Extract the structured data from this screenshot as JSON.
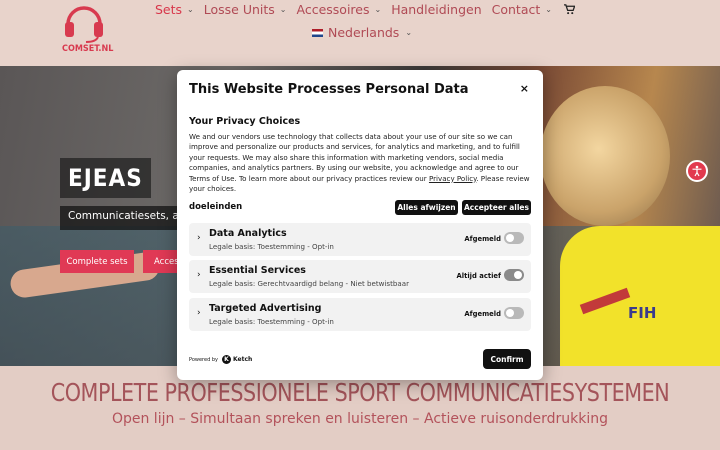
{
  "logo": {
    "text": "COMSET.NL",
    "icon": "headset-icon"
  },
  "nav": {
    "items": [
      {
        "label": "Sets",
        "active": true
      },
      {
        "label": "Losse Units"
      },
      {
        "label": "Accessoires"
      },
      {
        "label": "Handleidingen"
      },
      {
        "label": "Contact"
      }
    ],
    "cart_icon": "cart-icon",
    "language": "Nederlands",
    "chevron": "⌄"
  },
  "hero": {
    "brand": "EJEAS",
    "tagline": "Communicatiesets, accessoires",
    "button_complete": "Complete sets",
    "button_access": "Accessoires"
  },
  "footer": {
    "headline": "COMPLETE PROFESSIONELE SPORT COMMUNICATIESYSTEMEN",
    "subline": "Open lijn – Simultaan spreken en luisteren – Actieve ruisonderdrukking"
  },
  "consent": {
    "title": "This Website Processes Personal Data",
    "close": "×",
    "subtitle": "Your Privacy Choices",
    "body_pre": "We and our vendors use technology that collects data about your use of our site so we can improve and personalize our products and services, for analytics and marketing, and to fulfill your requests. We may also share this information with marketing vendors, social media companies, and analytics partners. By using our website, you acknowledge and agree to our Terms of Use. To learn more about our privacy practices review our ",
    "body_link": "Privacy Policy",
    "body_post": ". Please review your choices.",
    "purposes_label": "doeleinden",
    "reject_all": "Alles afwijzen",
    "accept_all": "Accepteer alles",
    "categories": [
      {
        "name": "Data Analytics",
        "basis": "Legale basis: Toestemming - Opt-in",
        "state": "Afgemeld"
      },
      {
        "name": "Essential Services",
        "basis": "Legale basis: Gerechtvaardigd belang - Niet betwistbaar",
        "state": "Altijd actief"
      },
      {
        "name": "Targeted Advertising",
        "basis": "Legale basis: Toestemming - Opt-in",
        "state": "Afgemeld"
      }
    ],
    "powered_by": "Powered by",
    "ketch": "Ketch",
    "confirm": "Confirm"
  },
  "colors": {
    "accent": "#e03955",
    "nav_text": "#b04a55",
    "headline": "#a4545a",
    "header_bg": "#e8d3cb"
  }
}
